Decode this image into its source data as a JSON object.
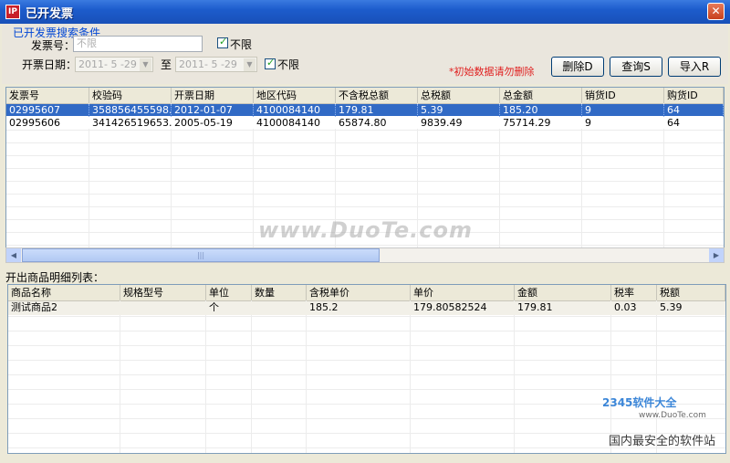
{
  "window": {
    "title": "已开发票",
    "icon_text": "IP"
  },
  "search": {
    "group_title": "已开发票搜索条件",
    "invoice_no_label": "发票号：",
    "invoice_no_placeholder": "不限",
    "unlimited_1": "不限",
    "date_label": "开票日期：",
    "date_from": "2011- 5 -29",
    "to_label": "至",
    "date_to": "2011- 5 -29",
    "unlimited_2": "不限",
    "hint": "*初始数据请勿删除"
  },
  "buttons": {
    "delete": "删除D",
    "query": "查询S",
    "import": "导入R"
  },
  "invoices": {
    "columns": [
      "发票号",
      "校验码",
      "开票日期",
      "地区代码",
      "不含税总额",
      "总税额",
      "总金额",
      "销货ID",
      "购货ID"
    ],
    "rows": [
      [
        "02995607",
        "358856455598...",
        "2012-01-07",
        "4100084140",
        "179.81",
        "5.39",
        "185.20",
        "9",
        "64"
      ],
      [
        "02995606",
        "341426519653...",
        "2005-05-19",
        "4100084140",
        "65874.80",
        "9839.49",
        "75714.29",
        "9",
        "64"
      ]
    ],
    "selected_row": 0
  },
  "detail": {
    "title": "开出商品明细列表：",
    "columns": [
      "商品名称",
      "规格型号",
      "单位",
      "数量",
      "含税单价",
      "单价",
      "金额",
      "税率",
      "税额"
    ],
    "rows": [
      [
        "测试商品2",
        "",
        "个",
        "",
        "185.2",
        "179.80582524",
        "179.81",
        "0.03",
        "5.39"
      ]
    ]
  },
  "watermarks": {
    "main": "www.DuoTe.com",
    "logo": "2345软件大全",
    "site": "www.DuoTe.com",
    "slogan": "国内最安全的软件站"
  },
  "colors": {
    "selection": "#316ac5",
    "titlebar": "#1d5ccc",
    "hint": "#e02020"
  }
}
